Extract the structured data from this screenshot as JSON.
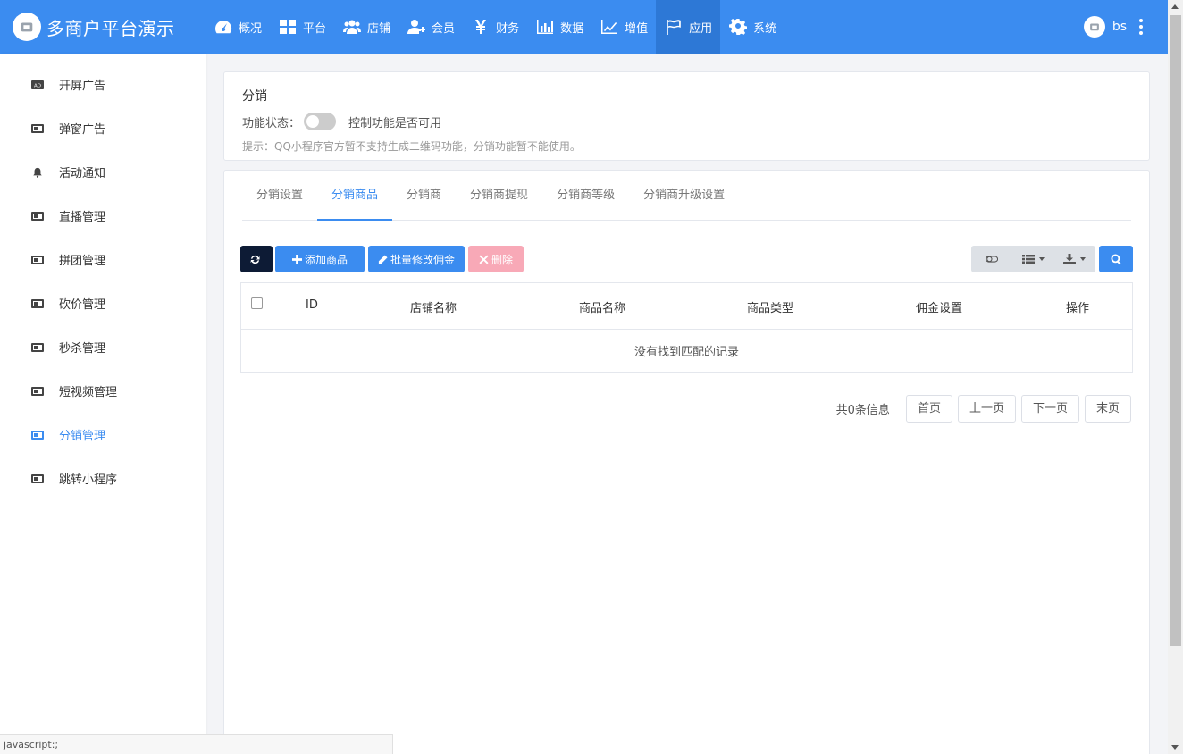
{
  "brand": {
    "name": "多商户平台演示"
  },
  "nav": [
    {
      "label": "概况",
      "icon": "dashboard-icon"
    },
    {
      "label": "平台",
      "icon": "grid-icon"
    },
    {
      "label": "店铺",
      "icon": "users-icon"
    },
    {
      "label": "会员",
      "icon": "user-plus-icon"
    },
    {
      "label": "财务",
      "icon": "yen-icon"
    },
    {
      "label": "数据",
      "icon": "bar-chart-icon"
    },
    {
      "label": "增值",
      "icon": "line-chart-icon"
    },
    {
      "label": "应用",
      "icon": "flag-icon"
    },
    {
      "label": "系统",
      "icon": "gear-icon"
    }
  ],
  "user": {
    "name": "bs"
  },
  "sidebar": {
    "items": [
      {
        "label": "开屏广告",
        "icon": "ad-icon"
      },
      {
        "label": "弹窗广告",
        "icon": "media-icon"
      },
      {
        "label": "活动通知",
        "icon": "bell-icon"
      },
      {
        "label": "直播管理",
        "icon": "media-icon"
      },
      {
        "label": "拼团管理",
        "icon": "media-icon"
      },
      {
        "label": "砍价管理",
        "icon": "media-icon"
      },
      {
        "label": "秒杀管理",
        "icon": "media-icon"
      },
      {
        "label": "短视频管理",
        "icon": "media-icon"
      },
      {
        "label": "分销管理",
        "icon": "media-icon"
      },
      {
        "label": "跳转小程序",
        "icon": "media-icon"
      }
    ]
  },
  "panel": {
    "title": "分销",
    "status_label": "功能状态：",
    "status_desc": "控制功能是否可用",
    "tip": "提示：QQ小程序官方暂不支持生成二维码功能，分销功能暂不能使用。"
  },
  "tabs": [
    "分销设置",
    "分销商品",
    "分销商",
    "分销商提现",
    "分销商等级",
    "分销商升级设置"
  ],
  "toolbar": {
    "add_label": "添加商品",
    "batch_label": "批量修改佣金",
    "delete_label": "删除"
  },
  "table": {
    "columns": [
      "ID",
      "店铺名称",
      "商品名称",
      "商品类型",
      "佣金设置",
      "操作"
    ],
    "empty_text": "没有找到匹配的记录"
  },
  "pager": {
    "info": "共0条信息",
    "first": "首页",
    "prev": "上一页",
    "next": "下一页",
    "last": "末页"
  },
  "statusbar": {
    "text": "javascript:;"
  },
  "colors": {
    "primary": "#3b8cf0",
    "dark": "#0d1b35",
    "danger_light": "#f8a9b7"
  }
}
